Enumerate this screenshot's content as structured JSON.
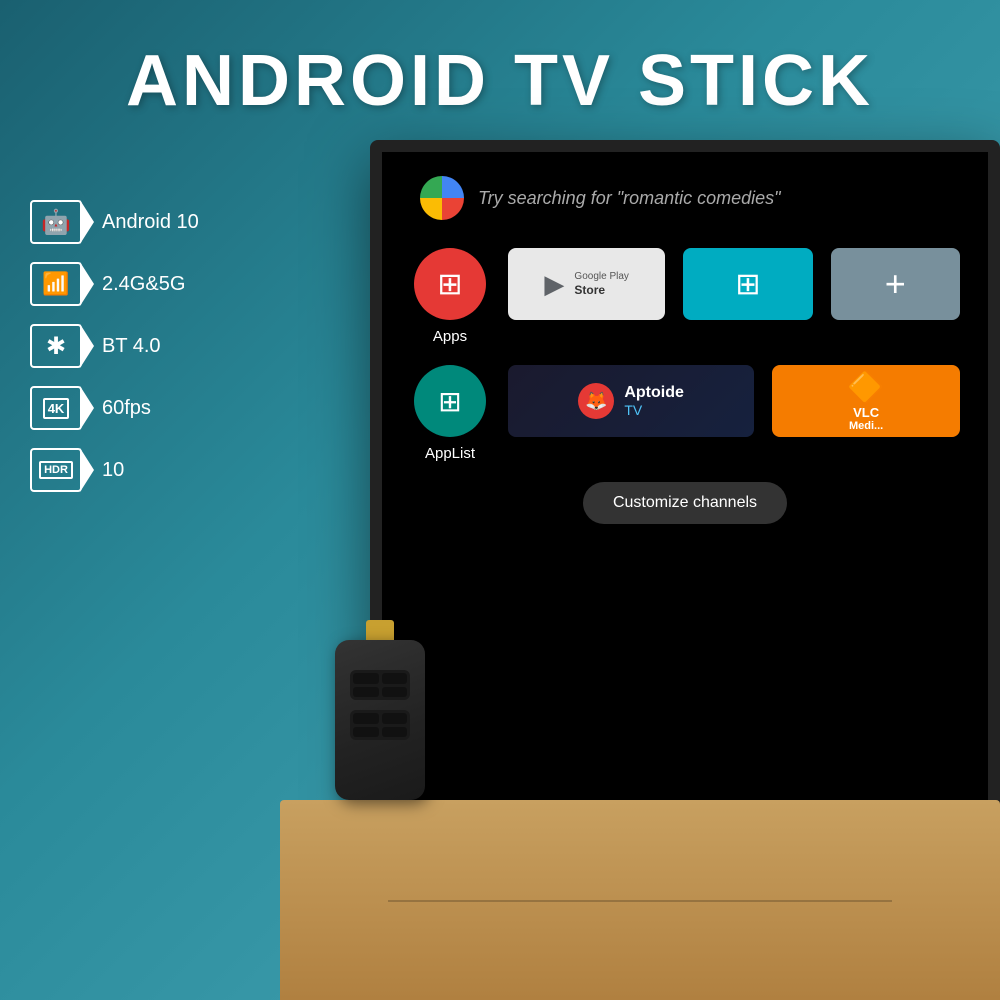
{
  "page": {
    "title": "ANDROID TV STICK",
    "background_color": "#2a7a8a"
  },
  "features": [
    {
      "id": "android",
      "icon": "android",
      "label": "Android 10",
      "badge_text": "🤖"
    },
    {
      "id": "wifi",
      "icon": "wifi",
      "label": "2.4G&5G",
      "badge_text": "📶"
    },
    {
      "id": "bluetooth",
      "icon": "bluetooth",
      "label": "BT 4.0",
      "badge_text": "✱"
    },
    {
      "id": "4k",
      "icon": "4k",
      "label": "60fps",
      "badge_text": "4K"
    },
    {
      "id": "hdr",
      "icon": "hdr",
      "label": "10",
      "badge_text": "HDR"
    }
  ],
  "tv_screen": {
    "assistant_text": "Try searching for \"romantic comedies\"",
    "apps_row": [
      {
        "id": "apps",
        "name": "Apps",
        "color": "red",
        "icon": "⊞"
      },
      {
        "id": "google-play",
        "name": "Google Play Store",
        "type": "tile"
      },
      {
        "id": "grid-app",
        "name": "Grid",
        "type": "tile",
        "color": "teal"
      },
      {
        "id": "plus-app",
        "name": "Add",
        "type": "tile",
        "color": "gray"
      }
    ],
    "apps_row2": [
      {
        "id": "applist",
        "name": "AppList",
        "color": "teal",
        "icon": "⊞"
      },
      {
        "id": "aptoide",
        "name": "Aptoide TV",
        "type": "tile"
      },
      {
        "id": "vlc",
        "name": "VLC Media",
        "type": "tile"
      }
    ],
    "customize_button": "Customize channels"
  },
  "device": {
    "name": "Android TV Stick"
  }
}
